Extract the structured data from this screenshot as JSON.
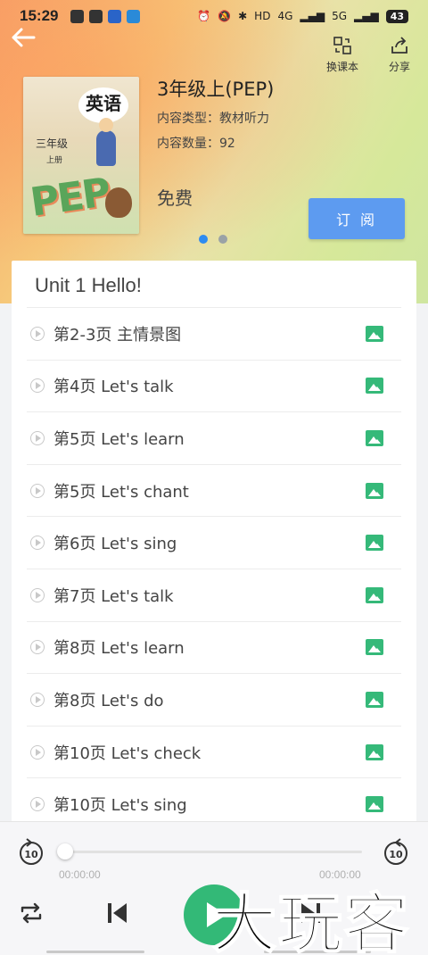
{
  "status_bar": {
    "time": "15:29",
    "battery": "43",
    "network": "4G",
    "network2": "5G",
    "hd": "HD"
  },
  "header": {
    "switch_book_label": "换课本",
    "share_label": "分享"
  },
  "book": {
    "cover_title": "英语",
    "cover_grade": "三年级",
    "cover_volume": "上册",
    "cover_pep": "PEP",
    "title": "3年级上(PEP)",
    "content_type_label": "内容类型：",
    "content_type": "教材听力",
    "content_count_label": "内容数量：",
    "content_count": "92",
    "price": "免费",
    "subscribe_label": "订 阅"
  },
  "carousel": {
    "count": 2,
    "active": 0
  },
  "unit": {
    "title": "Unit 1 Hello!",
    "tracks": [
      "第2-3页 主情景图",
      "第4页 Let's talk",
      "第5页 Let's learn",
      "第5页 Let's chant",
      "第6页 Let's sing",
      "第7页 Let's talk",
      "第8页 Let's learn",
      "第8页 Let's do",
      "第10页 Let's check",
      "第10页 Let's sing"
    ]
  },
  "player": {
    "rewind_seconds": "10",
    "forward_seconds": "10",
    "current_time": "00:00:00",
    "total_time": "00:00:00",
    "progress": 0
  },
  "watermark": "大玩客",
  "colors": {
    "accent_green": "#33b977",
    "button_blue": "#5d9bf0",
    "dot_active": "#2e8bf0"
  }
}
